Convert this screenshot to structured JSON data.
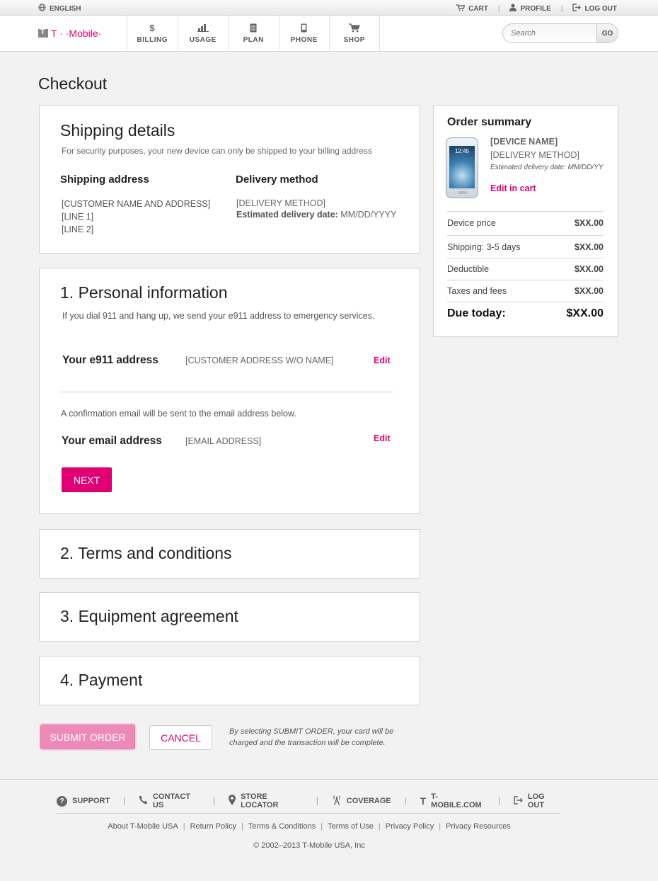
{
  "topbar": {
    "language": "ENGLISH",
    "cart": "CART",
    "profile": "PROFILE",
    "logout": "LOG OUT"
  },
  "nav": {
    "logo": "T · ·Mobile·",
    "items": [
      {
        "label": "BILLING",
        "icon": "dollar-icon"
      },
      {
        "label": "USAGE",
        "icon": "bar-chart-icon"
      },
      {
        "label": "PLAN",
        "icon": "document-icon"
      },
      {
        "label": "PHONE",
        "icon": "phone-icon"
      },
      {
        "label": "SHOP",
        "icon": "cart-icon"
      }
    ],
    "search_placeholder": "Search",
    "search_go": "GO"
  },
  "page": {
    "title": "Checkout"
  },
  "shipping": {
    "title": "Shipping details",
    "note": "For security purposes, your new device can only be shipped to your billing address",
    "address_heading": "Shipping address",
    "address_lines": [
      "[CUSTOMER NAME AND ADDRESS]",
      "[LINE 1]",
      "[LINE 2]"
    ],
    "delivery_heading": "Delivery method",
    "delivery_method": "[DELIVERY METHOD]",
    "delivery_date_label": "Estimated delivery date:",
    "delivery_date_value": "MM/DD/YYYY"
  },
  "personal": {
    "title": "1. Personal information",
    "note": "If you dial 911 and hang up, we send your e911 address to emergency services.",
    "e911_label": "Your e911 address",
    "e911_value": "[CUSTOMER ADDRESS W/O NAME]",
    "edit": "Edit",
    "email_note": "A confirmation email will be sent to the email address below.",
    "email_label": "Your email address",
    "email_value": "[EMAIL ADDRESS]",
    "next": "NEXT"
  },
  "steps": {
    "terms": "2. Terms and conditions",
    "equipment": "3. Equipment agreement",
    "payment": "4. Payment"
  },
  "actions": {
    "submit": "SUBMIT ORDER",
    "cancel": "CANCEL",
    "note": "By selecting SUBMIT ORDER, your card will be charged and the transaction will be complete."
  },
  "summary": {
    "title": "Order summary",
    "phone_clock": "12:45",
    "device_name": "[DEVICE NAME]",
    "delivery_method": "[DELIVERY METHOD]",
    "delivery_date": "Estimated delivery date: MM/DD/YY",
    "edit_cart": "Edit in cart",
    "rows": [
      {
        "label": "Device price",
        "value": "$XX.00"
      },
      {
        "label": "Shipping: 3-5 days",
        "value": "$XX.00"
      },
      {
        "label": "Deductible",
        "value": "$XX.00"
      },
      {
        "label": "Taxes and fees",
        "value": "$XX.00"
      }
    ],
    "total_label": "Due today:",
    "total_value": "$XX.00"
  },
  "footer": {
    "links": [
      {
        "label": "SUPPORT",
        "icon": "help-icon"
      },
      {
        "label": "CONTACT US",
        "icon": "phone-handset-icon"
      },
      {
        "label": "STORE LOCATOR",
        "icon": "map-pin-icon"
      },
      {
        "label": "COVERAGE",
        "icon": "antenna-icon"
      },
      {
        "label": "T-MOBILE.COM",
        "icon": "tmobile-t-icon"
      },
      {
        "label": "LOG OUT",
        "icon": "logout-icon"
      }
    ],
    "secondary_links": [
      "About T-Mobile USA",
      "Return Policy",
      "Terms & Conditions",
      "Terms of Use",
      "Privacy Policy",
      "Privacy Resources"
    ],
    "copyright": "© 2002–2013 T-Mobile USA, Inc"
  },
  "colors": {
    "accent": "#e20074",
    "submit_disabled": "#ee8ab8"
  }
}
